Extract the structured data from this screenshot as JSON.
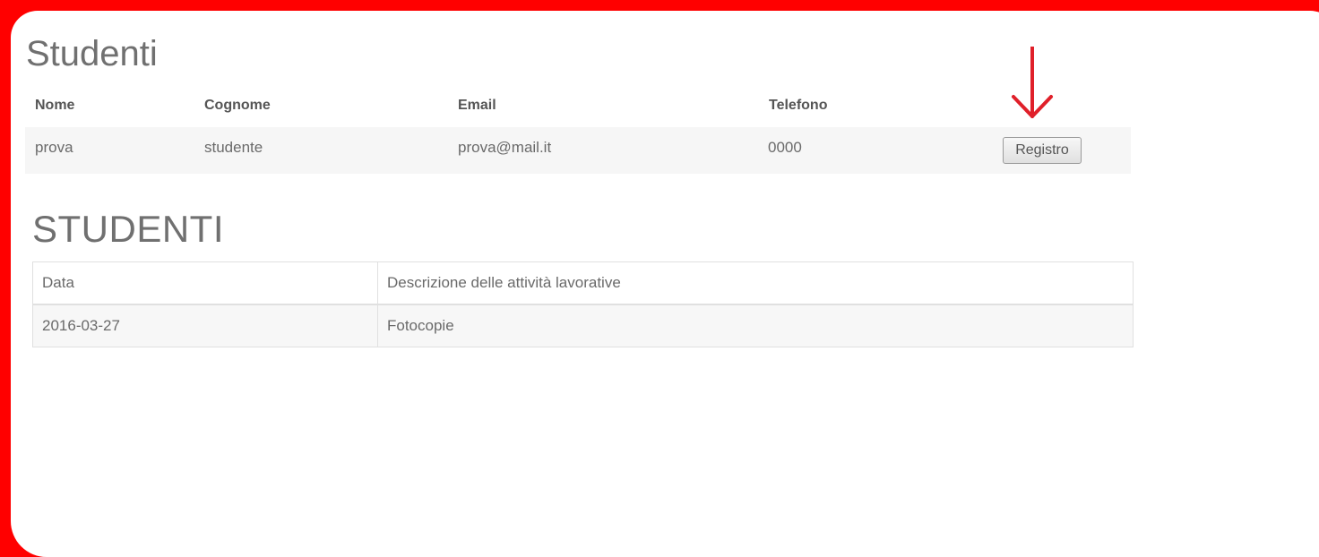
{
  "section1": {
    "title": "Studenti",
    "columns": [
      "Nome",
      "Cognome",
      "Email",
      "Telefono"
    ],
    "row": {
      "nome": "prova",
      "cognome": "studente",
      "email": "prova@mail.it",
      "telefono": "0000",
      "button_label": "Registro"
    }
  },
  "section2": {
    "title": "STUDENTI",
    "headers": [
      "Data",
      "Descrizione delle attività lavorative"
    ],
    "rows": [
      [
        "2016-03-27",
        "Fotocopie"
      ]
    ]
  },
  "colors": {
    "frame": "#ff0000",
    "arrow": "#e0202a",
    "text": "#6a6a6a"
  }
}
